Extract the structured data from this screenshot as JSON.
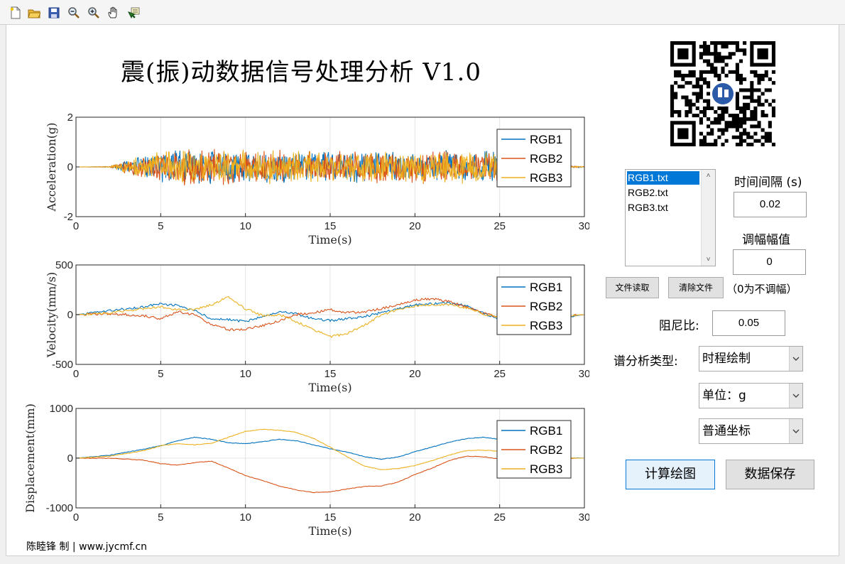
{
  "toolbar": {
    "items": [
      {
        "icon": "new-file-icon"
      },
      {
        "icon": "open-folder-icon"
      },
      {
        "icon": "save-icon"
      },
      {
        "icon": "zoom-out-icon"
      },
      {
        "icon": "zoom-in-icon"
      },
      {
        "icon": "pan-hand-icon"
      },
      {
        "icon": "data-cursor-icon"
      }
    ]
  },
  "header": {
    "title": "震(振)动数据信号处理分析   V1.0"
  },
  "colors": {
    "series1": "#0072bd",
    "series2": "#d95319",
    "series3": "#edb120",
    "selected": "#0078d7",
    "calc_button_bg": "#e5f1fb",
    "calc_button_border": "#0078d7"
  },
  "plots": [
    {
      "ylabel": "Acceleration(g)",
      "xlabel": "Time(s)",
      "yticks": [
        "2",
        "0",
        "-2"
      ],
      "xticks": [
        "0",
        "5",
        "10",
        "15",
        "20",
        "25",
        "30"
      ],
      "legend": [
        "RGB1",
        "RGB2",
        "RGB3"
      ]
    },
    {
      "ylabel": "Velocity(mm/s)",
      "xlabel": "Time(s)",
      "yticks": [
        "500",
        "0",
        "-500"
      ],
      "xticks": [
        "0",
        "5",
        "10",
        "15",
        "20",
        "25",
        "30"
      ],
      "legend": [
        "RGB1",
        "RGB2",
        "RGB3"
      ]
    },
    {
      "ylabel": "Displacement(mm)",
      "xlabel": "Time(s)",
      "yticks": [
        "1000",
        "0",
        "-1000"
      ],
      "xticks": [
        "0",
        "5",
        "10",
        "15",
        "20",
        "25",
        "30"
      ],
      "legend": [
        "RGB1",
        "RGB2",
        "RGB3"
      ]
    }
  ],
  "chart_data": [
    {
      "type": "line",
      "ylabel": "Acceleration(g)",
      "xlabel": "Time(s)",
      "xlim": [
        0,
        30
      ],
      "ylim": [
        -2,
        2
      ],
      "grid": true,
      "legend_position": "top-right",
      "x": [
        0,
        2,
        3,
        4,
        6,
        8,
        10,
        12,
        14,
        16,
        18,
        20,
        22,
        24,
        26,
        28,
        29,
        30
      ],
      "series": [
        {
          "name": "RGB1",
          "amplitude": [
            0,
            0.02,
            0.3,
            0.5,
            0.8,
            0.8,
            0.7,
            0.7,
            0.7,
            0.7,
            0.7,
            0.7,
            0.7,
            0.7,
            0.6,
            0.4,
            0.05,
            0.02
          ]
        },
        {
          "name": "RGB2",
          "amplitude": [
            0,
            0.02,
            0.3,
            0.5,
            0.8,
            0.8,
            0.7,
            0.7,
            0.7,
            0.7,
            0.7,
            0.7,
            0.7,
            0.7,
            0.6,
            0.4,
            0.05,
            0.02
          ]
        },
        {
          "name": "RGB3",
          "amplitude": [
            0,
            0.02,
            0.3,
            0.5,
            0.8,
            0.8,
            0.7,
            0.7,
            0.7,
            0.7,
            0.7,
            0.7,
            0.7,
            0.7,
            0.6,
            0.4,
            0.05,
            0.02
          ]
        }
      ]
    },
    {
      "type": "line",
      "ylabel": "Velocity(mm/s)",
      "xlabel": "Time(s)",
      "xlim": [
        0,
        30
      ],
      "ylim": [
        -500,
        500
      ],
      "grid": true,
      "legend_position": "top-right",
      "x": [
        0,
        2,
        4,
        5,
        6,
        7,
        8,
        9,
        10,
        11,
        12,
        13,
        14,
        15,
        16,
        17,
        18,
        19,
        20,
        21,
        22,
        23,
        24,
        25,
        26,
        27,
        28,
        29,
        30
      ],
      "series": [
        {
          "name": "RGB1",
          "values": [
            0,
            40,
            80,
            110,
            90,
            40,
            -40,
            -50,
            -70,
            -20,
            30,
            10,
            -40,
            -60,
            -40,
            -20,
            20,
            60,
            100,
            110,
            120,
            90,
            20,
            -50,
            -100,
            -130,
            -80,
            -20,
            0
          ]
        },
        {
          "name": "RGB2",
          "values": [
            0,
            10,
            -10,
            -40,
            30,
            0,
            -100,
            -150,
            -150,
            -110,
            -60,
            0,
            20,
            50,
            20,
            30,
            60,
            100,
            150,
            160,
            130,
            80,
            20,
            -30,
            -50,
            -80,
            -50,
            -10,
            0
          ]
        },
        {
          "name": "RGB3",
          "values": [
            0,
            20,
            60,
            80,
            50,
            50,
            100,
            180,
            60,
            -10,
            0,
            -70,
            -150,
            -220,
            -190,
            -110,
            0,
            50,
            90,
            100,
            100,
            70,
            10,
            -30,
            -40,
            -60,
            -50,
            -10,
            0
          ]
        }
      ]
    },
    {
      "type": "line",
      "ylabel": "Displacement(mm)",
      "xlabel": "Time(s)",
      "xlim": [
        0,
        30
      ],
      "ylim": [
        -1000,
        1000
      ],
      "grid": true,
      "legend_position": "top-right",
      "x": [
        0,
        2,
        4,
        5,
        6,
        7,
        8,
        9,
        10,
        11,
        12,
        13,
        14,
        15,
        16,
        17,
        18,
        19,
        20,
        21,
        22,
        23,
        24,
        25,
        26,
        27,
        28,
        29,
        30
      ],
      "series": [
        {
          "name": "RGB1",
          "values": [
            0,
            60,
            180,
            250,
            350,
            420,
            380,
            310,
            290,
            330,
            380,
            350,
            270,
            190,
            120,
            30,
            -20,
            20,
            130,
            220,
            320,
            390,
            420,
            380,
            280,
            150,
            60,
            10,
            0
          ]
        },
        {
          "name": "RGB2",
          "values": [
            0,
            0,
            -40,
            -110,
            -140,
            -90,
            -60,
            -200,
            -350,
            -450,
            -560,
            -640,
            -690,
            -680,
            -620,
            -570,
            -560,
            -480,
            -330,
            -200,
            -50,
            40,
            30,
            -20,
            -40,
            -20,
            -10,
            0,
            0
          ]
        },
        {
          "name": "RGB3",
          "values": [
            0,
            40,
            150,
            250,
            290,
            270,
            300,
            420,
            540,
            580,
            560,
            520,
            400,
            220,
            30,
            -160,
            -230,
            -210,
            -150,
            -50,
            60,
            150,
            160,
            140,
            80,
            20,
            0,
            0,
            0
          ]
        }
      ]
    }
  ],
  "files": {
    "items": [
      "RGB1.txt",
      "RGB2.txt",
      "RGB3.txt"
    ],
    "selected_index": 0
  },
  "controls": {
    "time_interval_label": "时间间隔 (s)",
    "time_interval_value": "0.02",
    "amplitude_label": "调幅幅值",
    "amplitude_value": "0",
    "read_button": "文件读取",
    "clear_button": "清除文件",
    "amplitude_note": "（0为不调幅）",
    "damping_label": "阻尼比:",
    "damping_value": "0.05",
    "spectrum_type_label": "谱分析类型:",
    "spectrum_type_value": "时程绘制",
    "unit_value": "单位：g",
    "coord_value": "普通坐标",
    "calc_button": "计算绘图",
    "save_button": "数据保存"
  },
  "footer": {
    "credit": "陈睦锋 制 | www.jycmf.cn"
  }
}
